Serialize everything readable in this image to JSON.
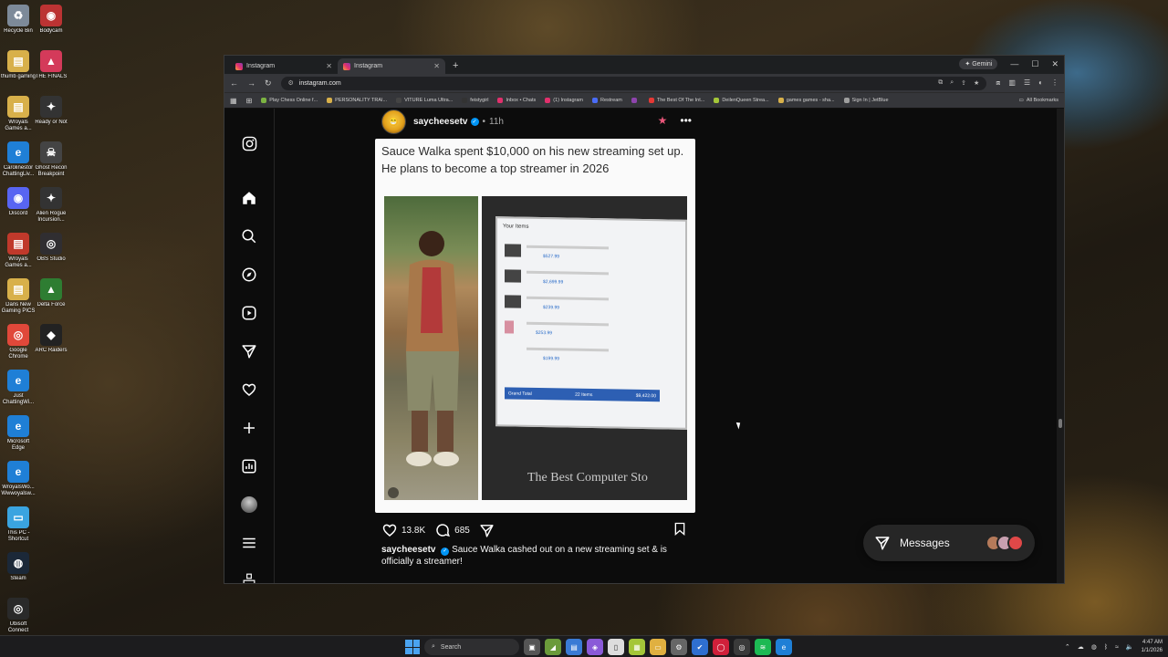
{
  "desktop": {
    "col1": [
      {
        "label": "Recycle Bin",
        "color": "#7d8a99",
        "glyph": "♻"
      },
      {
        "label": "thumb gaming",
        "color": "#d8b04a",
        "glyph": "▤"
      },
      {
        "label": "Wroyals Games a...",
        "color": "#d8b04a",
        "glyph": "▤"
      },
      {
        "label": "Carolinestor ChattingLiv...",
        "color": "#1f7fd6",
        "glyph": "e"
      },
      {
        "label": "Discord",
        "color": "#5865f2",
        "glyph": "◉"
      },
      {
        "label": "Wroyals Games a...",
        "color": "#c0392b",
        "glyph": "▤"
      },
      {
        "label": "Dans New Gaming PICS",
        "color": "#d8b04a",
        "glyph": "▤"
      },
      {
        "label": "Google Chrome",
        "color": "#e0483a",
        "glyph": "◎"
      },
      {
        "label": "Just ChattingWi...",
        "color": "#1f7fd6",
        "glyph": "e"
      },
      {
        "label": "Microsoft Edge",
        "color": "#1f7fd6",
        "glyph": "e"
      },
      {
        "label": "WroyalsWo... Wwwoyalsw...",
        "color": "#1f7fd6",
        "glyph": "e"
      },
      {
        "label": "This PC - Shortcut",
        "color": "#3aa4e0",
        "glyph": "▭"
      },
      {
        "label": "Steam",
        "color": "#1b2838",
        "glyph": "◍"
      },
      {
        "label": "Ubisoft Connect",
        "color": "#2a2a2a",
        "glyph": "◎"
      }
    ],
    "col2": [
      {
        "label": "Bodycam",
        "color": "#b33",
        "glyph": "◉"
      },
      {
        "label": "THE FINALS",
        "color": "#d43a5a",
        "glyph": "▲"
      },
      {
        "label": "Ready or Not",
        "color": "#333",
        "glyph": "✦"
      },
      {
        "label": "Ghost Recon Breakpoint",
        "color": "#444",
        "glyph": "☠"
      },
      {
        "label": "Alien Rogue Incursion...",
        "color": "#333",
        "glyph": "✦"
      },
      {
        "label": "OBS Studio",
        "color": "#302e31",
        "glyph": "◎"
      },
      {
        "label": "Delta Force",
        "color": "#2e7d32",
        "glyph": "▲"
      },
      {
        "label": "ARC Raiders",
        "color": "#222",
        "glyph": "◆"
      }
    ]
  },
  "browser": {
    "tabs": [
      {
        "title": "Instagram",
        "active": false
      },
      {
        "title": "Instagram",
        "active": true
      }
    ],
    "gemini_label": "Gemini",
    "url": "instagram.com",
    "bookmarks": [
      {
        "label": "Play Chess Online f...",
        "color": "#7cb342"
      },
      {
        "label": "PERSONALITY TRAI...",
        "color": "#d8b04a"
      },
      {
        "label": "VITURE Luma Ultra...",
        "color": "#444"
      },
      {
        "label": "feistygirl",
        "color": "#333"
      },
      {
        "label": "Inbox • Chats",
        "color": "#e1306c"
      },
      {
        "label": "(1) Instagram",
        "color": "#e1306c"
      },
      {
        "label": "Restream",
        "color": "#4a6cf7"
      },
      {
        "label": "",
        "color": "#8e44ad"
      },
      {
        "label": "The Best Of The Int...",
        "color": "#e53935"
      },
      {
        "label": "DeilenQueen Strea...",
        "color": "#a4c639"
      },
      {
        "label": "games games - sha...",
        "color": "#d8b04a"
      },
      {
        "label": "Sign In | JetBlue",
        "color": "#9e9e9e"
      }
    ],
    "all_bookmarks": "All Bookmarks"
  },
  "post": {
    "username": "saycheesetv",
    "time": "11h",
    "image_caption": "Sauce Walka spent $10,000 on his new streaming set up. He plans to become a top streamer in 2026",
    "receipt": {
      "header": "Your Items",
      "prices": [
        "$527.99",
        "$2,699.99",
        "$239.99",
        "$253.99",
        "$199.99"
      ],
      "grand_total_label": "Grand Total",
      "grand_items": "22 Items",
      "grand_total": "$9,422.00",
      "store_sign": "The Best Computer Sto"
    },
    "likes": "13.8K",
    "comments": "685",
    "caption_user": "saycheesetv",
    "caption_text": "Sauce Walka cashed out on a new streaming set & is officially a streamer!"
  },
  "messages": {
    "label": "Messages"
  },
  "taskbar": {
    "search_placeholder": "Search",
    "time": "4:47 AM",
    "date": "1/1/2026"
  },
  "colors": {
    "accent": "#0095f6",
    "ig_bg": "#0c0c0c"
  }
}
